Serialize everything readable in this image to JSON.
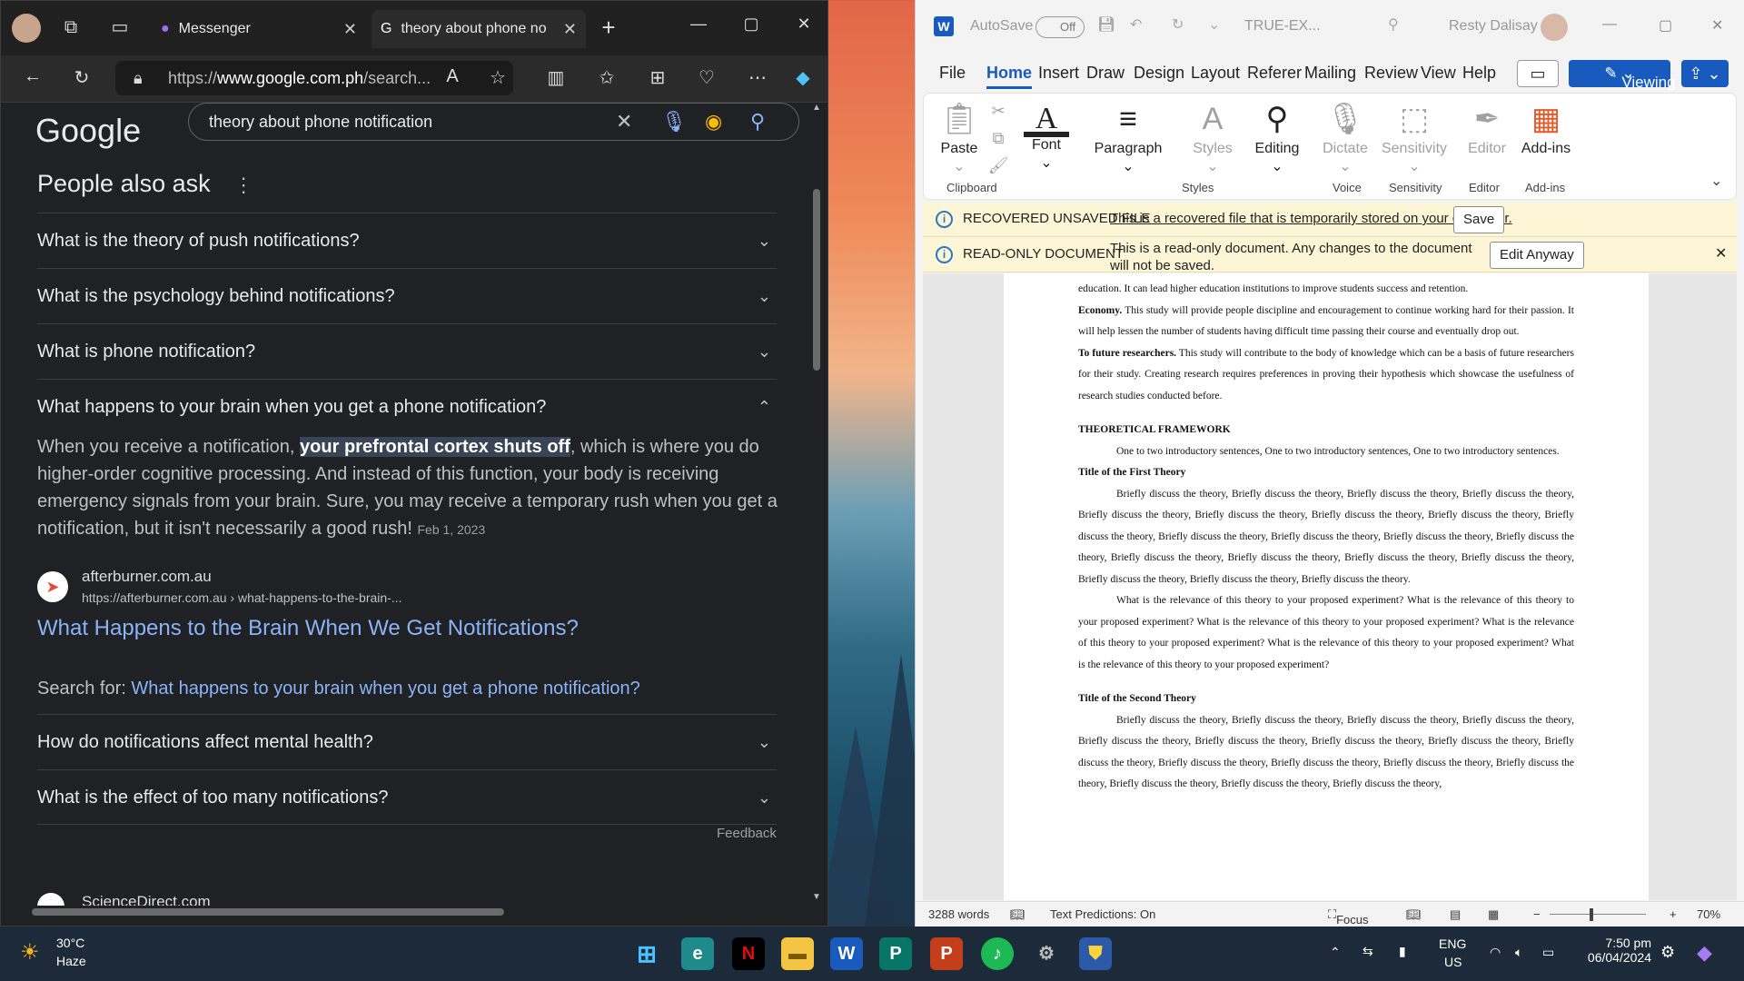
{
  "edge": {
    "tabs": [
      {
        "label": "Messenger"
      },
      {
        "label": "theory about phone not"
      }
    ],
    "address": {
      "prefix": "https://",
      "domain": "www.google.com.ph",
      "rest": "/search..."
    },
    "google": {
      "logo": "Google",
      "query": "theory about phone notification",
      "paa_title": "People also ask",
      "questions": [
        "What is the theory of push notifications?",
        "What is the psychology behind notifications?",
        "What is phone notification?",
        "What happens to your brain when you get a phone notification?"
      ],
      "answer_before": "When you receive a notification, ",
      "answer_highlight": "your prefrontal cortex shuts off",
      "answer_after": ", which is where you do higher-order cognitive processing. And instead of this function, your body is receiving emergency signals from your brain. Sure, you may receive a temporary rush when you get a notification, but it isn't necessarily a good rush!",
      "answer_date": "Feb 1, 2023",
      "source_site": "afterburner.com.au",
      "source_url": "https://afterburner.com.au › what-happens-to-the-brain-...",
      "source_title": "What Happens to the Brain When We Get Notifications?",
      "search_for_label": "Search for:",
      "search_for_link": "What happens to your brain when you get a phone notification?",
      "more_questions": [
        "How do notifications affect mental health?",
        "What is the effect of too many notifications?"
      ],
      "feedback": "Feedback",
      "next_result": "ScienceDirect.com"
    }
  },
  "word": {
    "autosave": "AutoSave",
    "autosave_state": "Off",
    "doc_name": "TRUE-EX...",
    "user": "Resty Dalisay",
    "menu": [
      "File",
      "Home",
      "Insert",
      "Draw",
      "Design",
      "Layout",
      "Referer",
      "Mailing",
      "Review",
      "View",
      "Help"
    ],
    "viewing": "Viewing",
    "ribbon": {
      "paste": "Paste",
      "font": "Font",
      "paragraph": "Paragraph",
      "styles": "Styles",
      "editing": "Editing",
      "dictate": "Dictate",
      "sensitivity": "Sensitivity",
      "editor": "Editor",
      "addins": "Add-ins",
      "groups": [
        "Clipboard",
        "Styles",
        "Voice",
        "Sensitivity",
        "Editor",
        "Add-ins"
      ]
    },
    "banner1": {
      "title": "RECOVERED UNSAVED FILE",
      "message": "This is a recovered file that is temporarily stored on your computer.",
      "button": "Save"
    },
    "banner2": {
      "title": "READ-ONLY DOCUMENT",
      "message": "This is a read-only document. Any changes to the document will not be saved.",
      "button": "Edit Anyway"
    },
    "doc": {
      "p1": "education. It can lead higher education institutions to improve students success and retention.",
      "p2_bold": "Economy.",
      "p2": " This study will provide people discipline and encouragement to continue working hard for their passion. It will help  lessen the number of students having difficult time passing their course and eventually drop out.",
      "p3_bold": "To future researchers.",
      "p3": " This study will contribute to the body of knowledge which can be a basis of future researchers for their study. Creating research requires preferences in proving their hypothesis which showcase the usefulness of research studies conducted before.",
      "h1": "THEORETICAL FRAMEWORK",
      "intro": "One to two introductory sentences, One to two introductory sentences, One to two introductory sentences.",
      "t1": "Title of the First Theory",
      "t1_body": "Briefly discuss the theory, Briefly discuss the theory, Briefly discuss the theory, Briefly discuss the theory, Briefly discuss the theory, Briefly discuss the theory, Briefly discuss the theory, Briefly discuss the theory, Briefly discuss the theory, Briefly discuss the theory, Briefly discuss the theory, Briefly discuss the theory, Briefly discuss the theory, Briefly discuss the theory, Briefly discuss the theory, Briefly discuss the theory, Briefly discuss the theory, Briefly discuss the theory, Briefly discuss the theory, Briefly discuss the theory.",
      "t1_rel": "What is the relevance of this theory to your proposed experiment? What is the relevance of this theory to your proposed experiment? What is the relevance of this theory to your proposed experiment? What is the relevance of this theory to your proposed experiment? What is the relevance of this theory to your proposed experiment? What is the relevance of this theory to your proposed experiment?",
      "t2": "Title of the Second Theory",
      "t2_body": "Briefly discuss the theory, Briefly discuss the theory, Briefly discuss the theory, Briefly discuss the theory, Briefly discuss the theory, Briefly discuss the theory, Briefly discuss the theory, Briefly discuss the theory, Briefly discuss the theory, Briefly discuss the theory, Briefly discuss the theory, Briefly discuss the theory, Briefly discuss the theory, Briefly discuss the theory, Briefly discuss the theory, Briefly discuss the theory,"
    },
    "status": {
      "words": "3288 words",
      "predictions": "Text Predictions: On",
      "focus": "Focus",
      "zoom": "70%"
    }
  },
  "taskbar": {
    "weather_temp": "30°C",
    "weather_desc": "Haze",
    "lang1": "ENG",
    "lang2": "US",
    "time": "7:50 pm",
    "date": "06/04/2024"
  },
  "colors": {
    "link": "#8ab4f8",
    "word_blue": "#185abd",
    "banner_bg": "#fdf6d6"
  }
}
